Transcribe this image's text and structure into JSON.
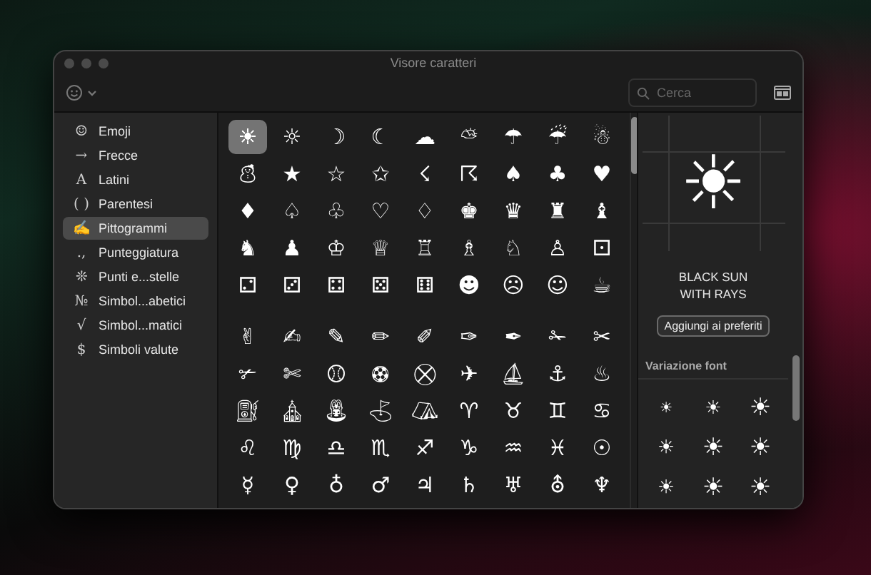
{
  "window": {
    "title": "Visore caratteri"
  },
  "toolbar": {
    "search": {
      "placeholder": "Cerca"
    }
  },
  "sidebar": {
    "items": [
      {
        "icon": "☺",
        "label": "Emoji",
        "selected": false
      },
      {
        "icon": "→",
        "label": "Frecce",
        "selected": false
      },
      {
        "icon": "A",
        "label": "Latini",
        "selected": false
      },
      {
        "icon": "( )",
        "label": "Parentesi",
        "selected": false
      },
      {
        "icon": "✍",
        "label": "Pittogrammi",
        "selected": true
      },
      {
        "icon": ".,",
        "label": "Punteggiatura",
        "selected": false
      },
      {
        "icon": "❊",
        "label": "Punti e...stelle",
        "selected": false
      },
      {
        "icon": "№",
        "label": "Simbol...abetici",
        "selected": false
      },
      {
        "icon": "√",
        "label": "Simbol...matici",
        "selected": false
      },
      {
        "icon": "$",
        "label": "Simboli valute",
        "selected": false
      }
    ]
  },
  "grid": {
    "sections": [
      {
        "characters": [
          {
            "char": "☀",
            "selected": true
          },
          {
            "char": "☼",
            "selected": false
          },
          {
            "char": "☽",
            "selected": false
          },
          {
            "char": "☾",
            "selected": false
          },
          {
            "char": "☁",
            "selected": false
          },
          {
            "char": "⛅",
            "selected": false
          },
          {
            "char": "☂",
            "selected": false
          },
          {
            "char": "☔",
            "selected": false
          },
          {
            "char": "☃",
            "selected": false
          },
          {
            "char": "⛄",
            "selected": false
          },
          {
            "char": "★",
            "selected": false
          },
          {
            "char": "☆",
            "selected": false
          },
          {
            "char": "✩",
            "selected": false
          },
          {
            "char": "☇",
            "selected": false
          },
          {
            "char": "☈",
            "selected": false
          },
          {
            "char": "♠",
            "selected": false
          },
          {
            "char": "♣",
            "selected": false
          },
          {
            "char": "♥",
            "selected": false
          },
          {
            "char": "♦",
            "selected": false
          },
          {
            "char": "♤",
            "selected": false
          },
          {
            "char": "♧",
            "selected": false
          },
          {
            "char": "♡",
            "selected": false
          },
          {
            "char": "♢",
            "selected": false
          },
          {
            "char": "♚",
            "selected": false
          },
          {
            "char": "♛",
            "selected": false
          },
          {
            "char": "♜",
            "selected": false
          },
          {
            "char": "♝",
            "selected": false
          },
          {
            "char": "♞",
            "selected": false
          },
          {
            "char": "♟",
            "selected": false
          },
          {
            "char": "♔",
            "selected": false
          },
          {
            "char": "♕",
            "selected": false
          },
          {
            "char": "♖",
            "selected": false
          },
          {
            "char": "♗",
            "selected": false
          },
          {
            "char": "♘",
            "selected": false
          },
          {
            "char": "♙",
            "selected": false
          },
          {
            "char": "⚀",
            "selected": false
          },
          {
            "char": "⚁",
            "selected": false
          },
          {
            "char": "⚂",
            "selected": false
          },
          {
            "char": "⚃",
            "selected": false
          },
          {
            "char": "⚄",
            "selected": false
          },
          {
            "char": "⚅",
            "selected": false
          },
          {
            "char": "☻",
            "selected": false
          },
          {
            "char": "☹",
            "selected": false
          },
          {
            "char": "☺",
            "selected": false
          },
          {
            "char": "☕",
            "selected": false
          }
        ]
      },
      {
        "characters": [
          {
            "char": "✌",
            "selected": false
          },
          {
            "char": "✍",
            "selected": false
          },
          {
            "char": "✎",
            "selected": false
          },
          {
            "char": "✏",
            "selected": false
          },
          {
            "char": "✐",
            "selected": false
          },
          {
            "char": "✑",
            "selected": false
          },
          {
            "char": "✒",
            "selected": false
          },
          {
            "char": "✁",
            "selected": false
          },
          {
            "char": "✂",
            "selected": false
          },
          {
            "char": "✃",
            "selected": false
          },
          {
            "char": "✄",
            "selected": false
          },
          {
            "char": "⚾",
            "selected": false
          },
          {
            "char": "⚽",
            "selected": false
          },
          {
            "char": "⛒",
            "selected": false
          },
          {
            "char": "✈",
            "selected": false
          },
          {
            "char": "⛵",
            "selected": false
          },
          {
            "char": "⚓",
            "selected": false
          },
          {
            "char": "♨",
            "selected": false
          },
          {
            "char": "⛽",
            "selected": false
          },
          {
            "char": "⛪",
            "selected": false
          },
          {
            "char": "⛲",
            "selected": false
          },
          {
            "char": "⛳",
            "selected": false
          },
          {
            "char": "⛺",
            "selected": false
          },
          {
            "char": "♈",
            "selected": false
          },
          {
            "char": "♉",
            "selected": false
          },
          {
            "char": "♊",
            "selected": false
          },
          {
            "char": "♋",
            "selected": false
          },
          {
            "char": "♌",
            "selected": false
          },
          {
            "char": "♍",
            "selected": false
          },
          {
            "char": "♎",
            "selected": false
          },
          {
            "char": "♏",
            "selected": false
          },
          {
            "char": "♐",
            "selected": false
          },
          {
            "char": "♑",
            "selected": false
          },
          {
            "char": "♒",
            "selected": false
          },
          {
            "char": "♓",
            "selected": false
          },
          {
            "char": "☉",
            "selected": false
          },
          {
            "char": "☿",
            "selected": false
          },
          {
            "char": "♀",
            "selected": false
          },
          {
            "char": "♁",
            "selected": false
          },
          {
            "char": "♂",
            "selected": false
          },
          {
            "char": "♃",
            "selected": false
          },
          {
            "char": "♄",
            "selected": false
          },
          {
            "char": "♅",
            "selected": false
          },
          {
            "char": "⛢",
            "selected": false
          },
          {
            "char": "♆",
            "selected": false
          }
        ]
      }
    ]
  },
  "detail": {
    "preview": "☀",
    "name": "BLACK SUN WITH RAYS",
    "button": "Aggiungi ai preferiti",
    "variations": {
      "title": "Variazione font",
      "characters": [
        "☀",
        "☀",
        "☀",
        "☀",
        "☀",
        "☀",
        "☀",
        "☀",
        "☀"
      ]
    }
  }
}
